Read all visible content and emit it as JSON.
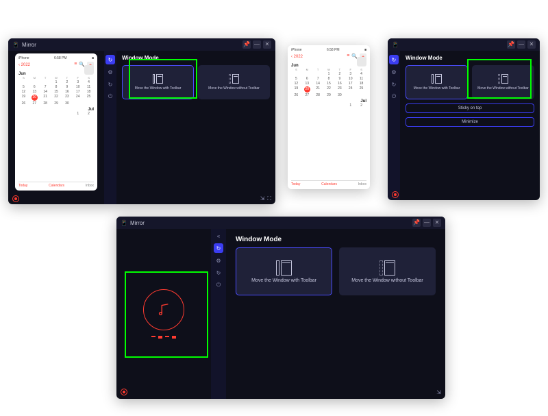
{
  "app": {
    "title": "Mirror"
  },
  "titlebar": {
    "pin": "📌",
    "min": "—",
    "close": "✕"
  },
  "phone": {
    "statusLeft": "iPhone",
    "statusTime": "6:58 PM",
    "statusRight": "■",
    "backYear": "‹ 2022",
    "listIcon": "≡",
    "searchIcon": "🔍",
    "plusIcon": "+",
    "months": {
      "jun": "Jun",
      "jul": "Jul"
    },
    "dayHeaders": [
      "S",
      "M",
      "T",
      "W",
      "T",
      "F",
      "S"
    ],
    "junRows": [
      [
        "",
        "",
        "",
        "1",
        "2",
        "3",
        "4"
      ],
      [
        "5",
        "6",
        "7",
        "8",
        "9",
        "10",
        "11"
      ],
      [
        "12",
        "13",
        "14",
        "15",
        "16",
        "17",
        "18"
      ],
      [
        "19",
        "20",
        "21",
        "22",
        "23",
        "24",
        "25"
      ],
      [
        "26",
        "27",
        "28",
        "29",
        "30",
        "",
        ""
      ]
    ],
    "today": "20",
    "julRow1": [
      "",
      "",
      "",
      "",
      "",
      "1",
      "2"
    ],
    "tabs": {
      "today": "Today",
      "calendars": "Calendars",
      "inbox": "Inbox"
    }
  },
  "sidebar": {
    "collapse": "«",
    "items": [
      {
        "name": "link-icon",
        "glyph": "↻",
        "active": true
      },
      {
        "name": "settings-icon",
        "glyph": "⚙"
      },
      {
        "name": "refresh-icon",
        "glyph": "↻"
      },
      {
        "name": "power-icon",
        "glyph": "⏻"
      }
    ]
  },
  "section": {
    "title": "Window Mode"
  },
  "cards": {
    "withToolbar": "Move the Window with Toolbar",
    "withoutToolbar": "Move the Window without Toolbar"
  },
  "buttons": {
    "sticky": "Sticky on top",
    "minimize": "Minimize"
  },
  "bottombar": {
    "expand": "⇲",
    "fullscreen": "⛶"
  }
}
